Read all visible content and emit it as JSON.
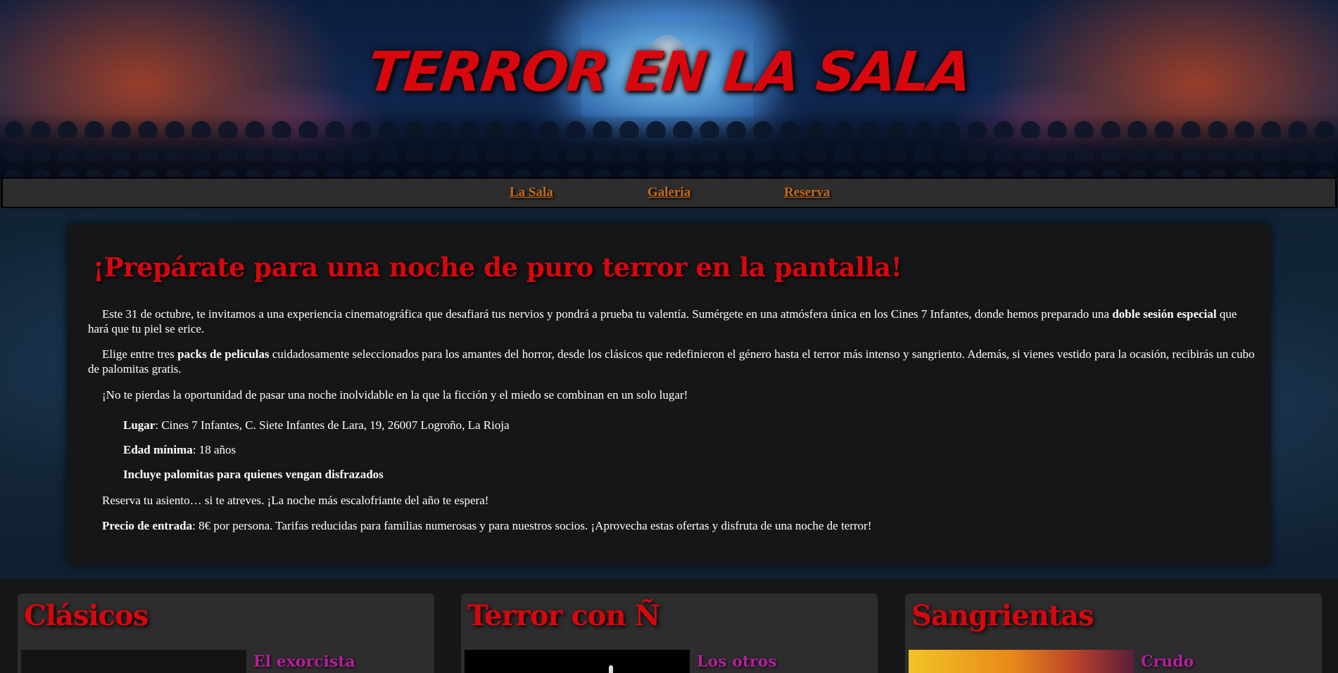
{
  "header": {
    "title": "TERROR EN LA SALA"
  },
  "nav": {
    "items": [
      {
        "label": "La Sala"
      },
      {
        "label": "Galeria"
      },
      {
        "label": "Reserva"
      }
    ]
  },
  "main": {
    "heading": "¡Prepárate para una noche de puro terror en la pantalla!",
    "p1": {
      "a": "Este 31 de octubre, te invitamos a una experiencia cinematográfica que desafiará tus nervios y pondrá a prueba tu valentía. Sumérgete en una atmósfera única en los Cines 7 Infantes, donde hemos preparado una ",
      "bold": "doble sesión especial",
      "b": " que hará que tu piel se erice."
    },
    "p2": {
      "a": "Elige entre tres ",
      "bold": "packs de películas",
      "b": " cuidadosamente seleccionados para los amantes del horror, desde los clásicos que redefinieron el género hasta el terror más intenso y sangriento. Además, si vienes vestido para la ocasión, recibirás un cubo de palomitas gratis."
    },
    "p3": "¡No te pierdas la oportunidad de pasar una noche inolvidable en la que la ficción y el miedo se combinan en un solo lugar!",
    "details": {
      "lugar_label": "Lugar",
      "lugar_value": ": Cines 7 Infantes, C. Siete Infantes de Lara, 19, 26007 Logroño, La Rioja",
      "edad_label": "Edad mínima",
      "edad_value": ": 18 años",
      "palomitas": "Incluye palomitas para quienes vengan disfrazados"
    },
    "p4": "Reserva tu asiento… si te atreves. ¡La noche más escalofriante del año te espera!",
    "p5": {
      "label": "Precio de entrada",
      "value": ": 8€ por persona. Tarifas reducidas para familias numerosas y para nuestros socios. ¡Aprovecha estas ofertas y disfruta de una noche de terror!"
    }
  },
  "packs": [
    {
      "title": "Clásicos",
      "movie": "El exorcista"
    },
    {
      "title": "Terror con Ñ",
      "movie": "Los otros"
    },
    {
      "title": "Sangrientas",
      "movie": "Crudo"
    }
  ],
  "colors": {
    "title_red": "#d8070d",
    "nav_orange": "#c96a12",
    "movie_magenta": "#b51e9c",
    "panel_gray": "#2d2d2d",
    "card_dark": "#151617"
  }
}
